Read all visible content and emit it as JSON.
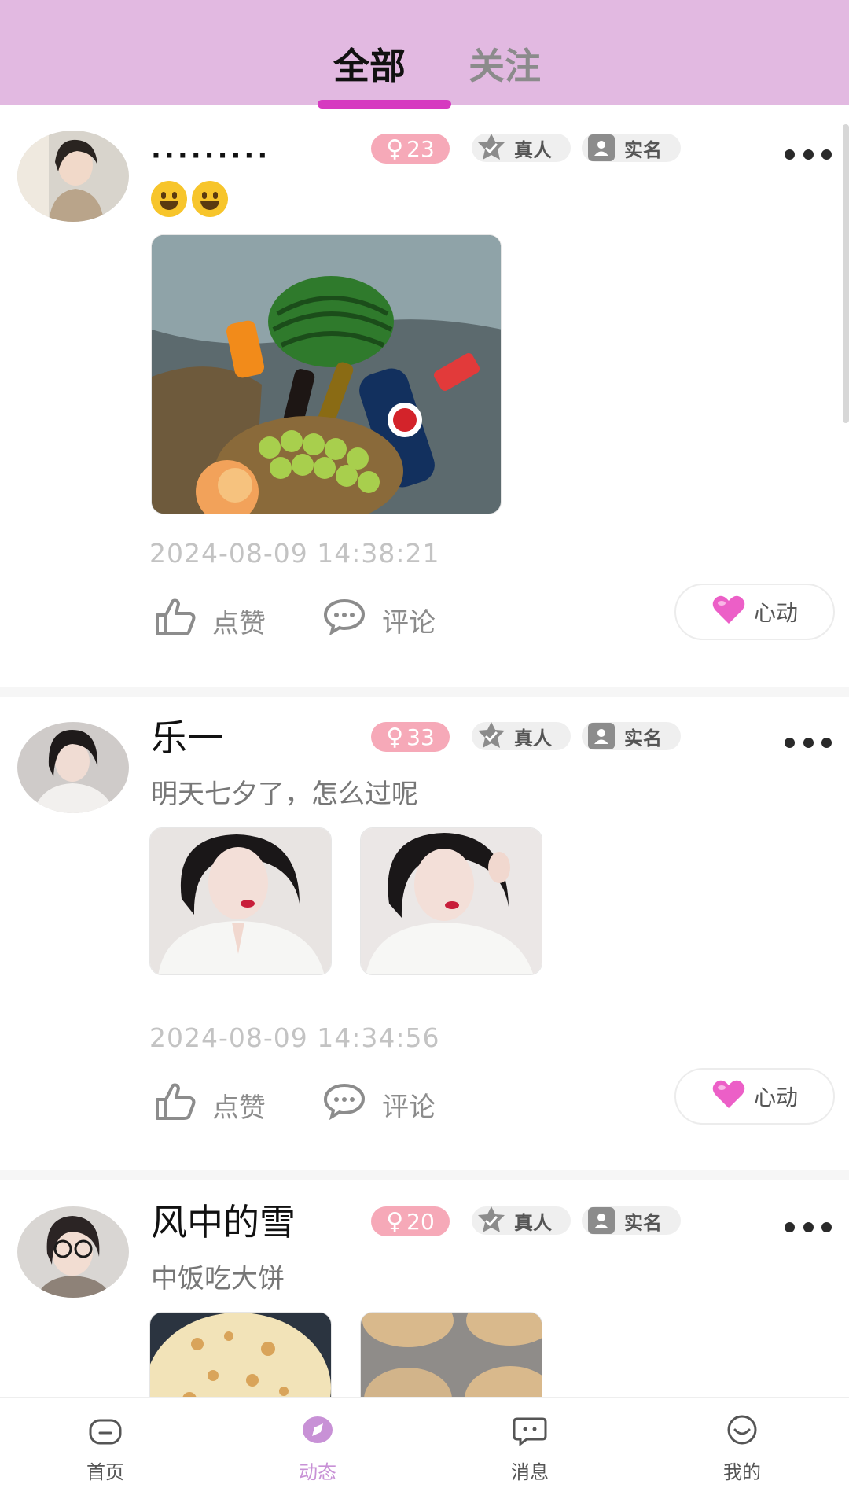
{
  "header": {
    "tabs": [
      {
        "label": "全部",
        "active": true
      },
      {
        "label": "关注",
        "active": false
      }
    ]
  },
  "posts": [
    {
      "username": "·········",
      "age": "23",
      "gender_symbol": "♀",
      "badge_real": "真人",
      "badge_realname": "实名",
      "text": "",
      "emojis": [
        "grinning-face",
        "grinning-face"
      ],
      "photo_count": 1,
      "timestamp": "2024-08-09 14:38:21",
      "like_label": "点赞",
      "comment_label": "评论",
      "heart_label": "心动"
    },
    {
      "username": "乐一",
      "age": "33",
      "gender_symbol": "♀",
      "badge_real": "真人",
      "badge_realname": "实名",
      "text": "明天七夕了，怎么过呢",
      "photo_count": 2,
      "timestamp": "2024-08-09 14:34:56",
      "like_label": "点赞",
      "comment_label": "评论",
      "heart_label": "心动"
    },
    {
      "username": "风中的雪",
      "age": "20",
      "gender_symbol": "♀",
      "badge_real": "真人",
      "badge_realname": "实名",
      "text": "中饭吃大饼",
      "photo_count": 2
    }
  ],
  "bottom_nav": [
    {
      "label": "首页",
      "icon": "home-icon",
      "active": false
    },
    {
      "label": "动态",
      "icon": "compass-icon",
      "active": true
    },
    {
      "label": "消息",
      "icon": "message-icon",
      "active": false
    },
    {
      "label": "我的",
      "icon": "profile-icon",
      "active": false
    }
  ],
  "colors": {
    "header_bg": "#e2b9e1",
    "tab_indicator": "#d63ac0",
    "age_badge": "#f6a9b8",
    "heart": "#ec5fc7",
    "nav_active": "#c891d6"
  }
}
